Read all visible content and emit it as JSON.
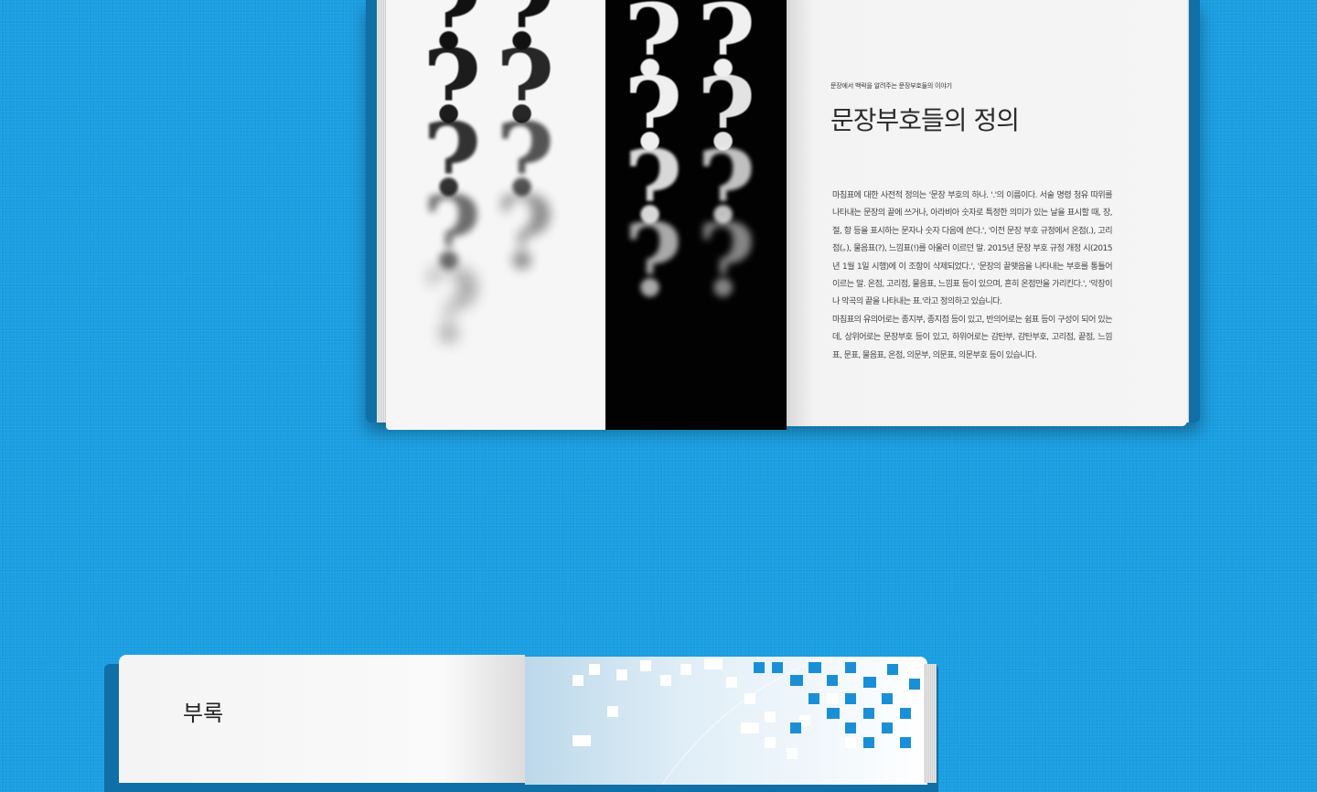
{
  "book_top": {
    "left_page": {
      "question_mark_glyph": "?"
    },
    "right_page": {
      "kicker": "문장에서 백락을 알려주는 문장부호들의 이야기",
      "title": "문장부호들의 정의",
      "paragraph_1": "마침표에 대한 사전적 정의는 '문장 부호의 하나. '.'의 이름이다. 서술 명령 청유 따위를 나타내는 문장의 끝에 쓰거나, 아라비아 숫자로 특정한 의미가 있는 날을 표시할 때, 장, 절, 항 등을 표시하는 문자나 숫자 다음에 쓴다.', '이전 문장 부호 규정에서 온점(.), 고리점(。), 물음표(?), 느낌표(!)를 아울러 이르던 말. 2015년 문장 부호 규정 개정 시(2015년 1월 1일 시행)에 이 조항이 삭제되었다.', '문장의 끝맺음을 나타내는 부호를 통틀어 이르는 말. 온점, 고리점, 물음표, 느낌표 등이 있으며, 흔히 온점만을 가리킨다.', '악장이나 악곡의 끝을 나타내는 표.'라고 정의하고 있습니다.",
      "paragraph_2": "마침표의 유의어로는 종지부, 종지점 등이 있고, 반의어로는 쉼표 등이 구성이 되어 있는데, 상위어로는 문장부호 등이 있고, 하위어로는 감탄부, 감탄부호, 고리점, 끝점, 느낌표, 문표, 물음표, 온점, 의문부, 의문표, 의문부호 등이 있습니다."
    }
  },
  "book_bottom": {
    "left_page": {
      "title": "부록"
    }
  },
  "colors": {
    "background": "#1a9fe3",
    "cover": "#0f6fa6",
    "page": "#f5f5f5",
    "black_panel": "#020202",
    "pixel_blue": "#1a8fd6"
  }
}
